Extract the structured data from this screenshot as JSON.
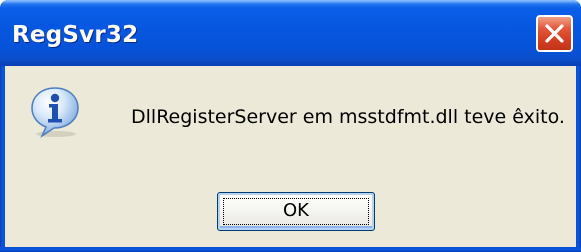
{
  "window": {
    "title": "RegSvr32",
    "close_icon": "close-icon"
  },
  "dialog": {
    "icon": "info-icon",
    "message": "DllRegisterServer em msstdfmt.dll teve êxito.",
    "ok_label": "OK"
  },
  "colors": {
    "titlebar": "#0757e0",
    "client_background": "#ece9d8",
    "close_button": "#d33e20",
    "button_border": "#003c74"
  }
}
